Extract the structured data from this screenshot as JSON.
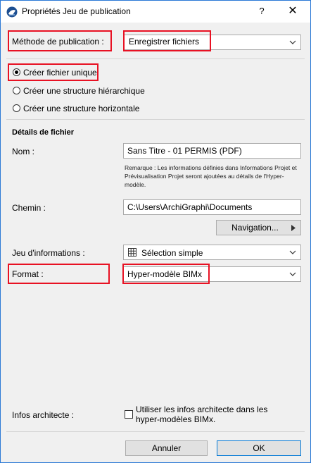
{
  "window": {
    "title": "Propriétés Jeu de publication",
    "help_label": "?",
    "close_label": "✕"
  },
  "publish_method": {
    "label": "Méthode de publication :",
    "value": "Enregistrer fichiers"
  },
  "structure_options": [
    {
      "label": "Créer fichier unique",
      "selected": true
    },
    {
      "label": "Créer une structure hiérarchique",
      "selected": false
    },
    {
      "label": "Créer une structure horizontale",
      "selected": false
    }
  ],
  "file_details": {
    "heading": "Détails de fichier",
    "name_label": "Nom :",
    "name_value": "Sans Titre - 01 PERMIS (PDF)",
    "remark": "Remarque : Les informations définies dans Informations Projet et Prévisualisation Projet seront ajoutées au détails de l'Hyper-modèle.",
    "path_label": "Chemin :",
    "path_value": "C:\\Users\\ArchiGraphi\\Documents",
    "navigation_label": "Navigation...",
    "info_set_label": "Jeu d'informations :",
    "info_set_value": "Sélection simple",
    "format_label": "Format :",
    "format_value": "Hyper-modèle BIMx"
  },
  "architect": {
    "label": "Infos architecte :",
    "checkbox_label_line1": "Utiliser les infos architecte dans les",
    "checkbox_label_line2": "hyper-modèles BIMx.",
    "checked": false
  },
  "footer": {
    "cancel_label": "Annuler",
    "ok_label": "OK"
  },
  "colors": {
    "highlight_box": "#e81123",
    "window_border": "#2b79d6",
    "dialog_bg": "#f0f0f0"
  }
}
